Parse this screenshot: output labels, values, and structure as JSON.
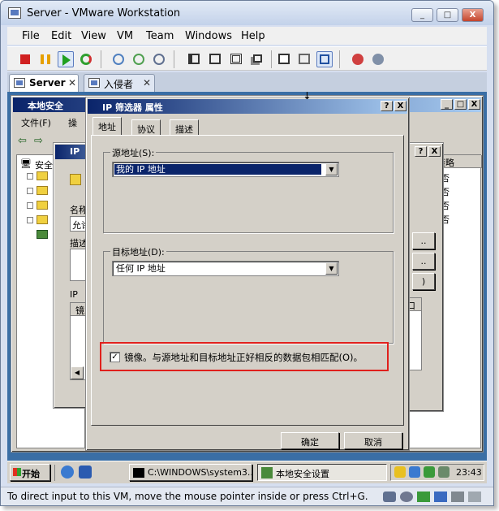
{
  "window": {
    "title": "Server - VMware Workstation",
    "min": "_",
    "max": "□",
    "close": "X"
  },
  "menubar": [
    "File",
    "Edit",
    "View",
    "VM",
    "Team",
    "Windows",
    "Help"
  ],
  "tabs": [
    {
      "label": "Server",
      "active": true
    },
    {
      "label": "入侵者",
      "active": false
    }
  ],
  "bg_window": {
    "title": "本地安全",
    "menu": [
      "文件(F)",
      "操"
    ],
    "tree": [
      "安全"
    ],
    "policy_header": "策略",
    "policy_values": [
      "否",
      "否",
      "否",
      "否"
    ],
    "side_text": "可被",
    "port_text": "口"
  },
  "mid_window": {
    "title": "IP",
    "labels": {
      "name": "名称",
      "desc": "描述",
      "ip": "IP",
      "mirror": "镜"
    },
    "name_value": "允许"
  },
  "dialog": {
    "title": "IP 筛选器 属性",
    "help": "?",
    "close": "X",
    "tabs": [
      "地址",
      "协议",
      "描述"
    ],
    "source": {
      "label": "源地址(S):",
      "value": "我的 IP 地址"
    },
    "dest": {
      "label": "目标地址(D):",
      "value": "任何 IP 地址"
    },
    "mirror": {
      "label": "镜像。与源地址和目标地址正好相反的数据包相匹配(O)。",
      "checked": true
    },
    "ok": "确定",
    "cancel": "取消"
  },
  "taskbar": {
    "start": "开始",
    "items": [
      "C:\\WINDOWS\\system3...",
      "本地安全设置"
    ],
    "time": "23:43"
  },
  "status": "To direct input to this VM, move the mouse pointer inside or press Ctrl+G.",
  "colors": {
    "highlight": "#0a246a",
    "annotation": "#e0201c",
    "desktop": "#3a6ea5"
  }
}
